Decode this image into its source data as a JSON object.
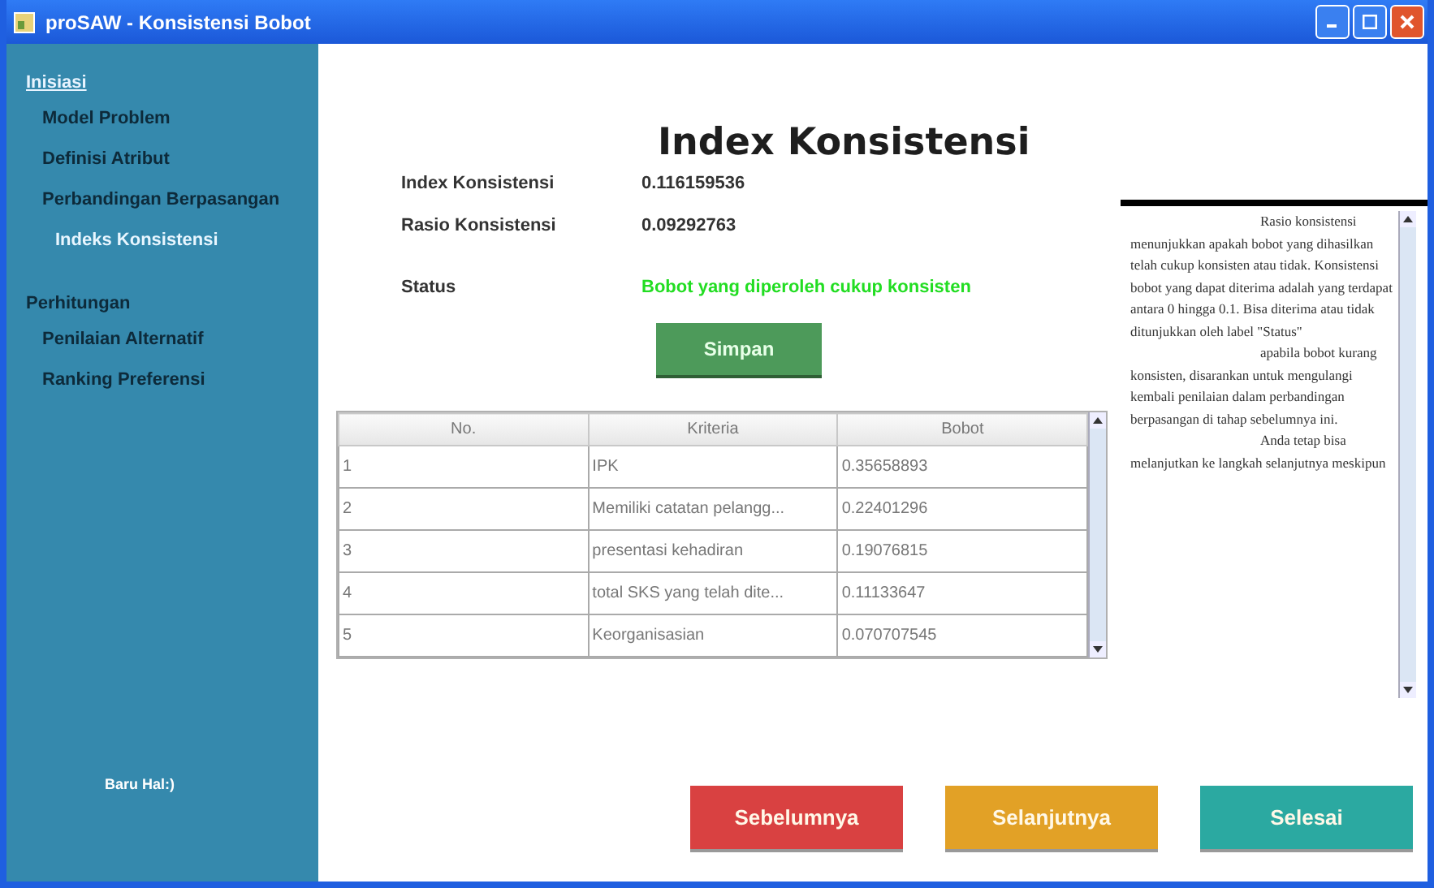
{
  "window": {
    "title": "proSAW - Konsistensi Bobot"
  },
  "sidebar": {
    "sections": [
      {
        "label": "Inisiasi",
        "items": [
          {
            "label": "Model Problem",
            "selected": false
          },
          {
            "label": "Definisi Atribut",
            "selected": false
          },
          {
            "label": "Perbandingan Berpasangan",
            "selected": false
          },
          {
            "label": "Indeks Konsistensi",
            "selected": true
          }
        ]
      },
      {
        "label": "Perhitungan",
        "items": [
          {
            "label": "Penilaian Alternatif",
            "selected": false
          },
          {
            "label": "Ranking Preferensi",
            "selected": false
          }
        ]
      }
    ],
    "footer": "Baru Hal:)"
  },
  "heading": "Index Konsistensi",
  "fields": [
    {
      "label": "Index Konsistensi",
      "value": "0.116159536",
      "kind": "plain"
    },
    {
      "label": "Rasio Konsistensi",
      "value": "0.09292763",
      "kind": "plain"
    },
    {
      "label": "Status",
      "value": "Bobot yang diperoleh cukup konsisten",
      "kind": "status"
    }
  ],
  "save_button": "Simpan",
  "table": {
    "columns": [
      "No.",
      "Kriteria",
      "Bobot"
    ],
    "rows": [
      [
        "1",
        "IPK",
        "0.35658893"
      ],
      [
        "2",
        "Memiliki catatan pelangg...",
        "0.22401296"
      ],
      [
        "3",
        "presentasi kehadiran",
        "0.19076815"
      ],
      [
        "4",
        "total SKS yang telah dite...",
        "0.11133647"
      ],
      [
        "5",
        "Keorganisasian",
        "0.070707545"
      ]
    ]
  },
  "help_text": [
    "Rasio konsistensi menunjukkan apakah bobot yang dihasilkan telah cukup konsisten atau tidak. Konsistensi bobot yang dapat diterima adalah yang terdapat antara 0 hingga 0.1. Bisa diterima atau tidak ditunjukkan oleh label \"Status\"",
    "apabila bobot kurang konsisten, disarankan untuk mengulangi kembali penilaian dalam perbandingan berpasangan di tahap sebelumnya ini.",
    "Anda tetap bisa melanjutkan ke langkah selanjutnya meskipun"
  ],
  "nav_buttons": [
    {
      "label": "Sebelumnya",
      "color": "#d94141"
    },
    {
      "label": "Selanjutnya",
      "color": "#e2a126"
    },
    {
      "label": "Selesai",
      "color": "#2ba9a1"
    }
  ]
}
